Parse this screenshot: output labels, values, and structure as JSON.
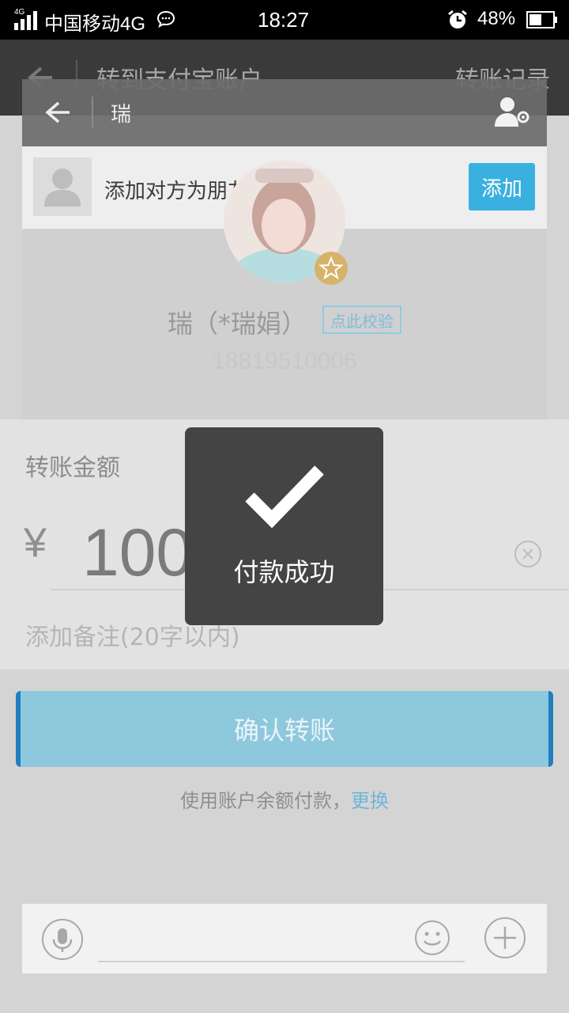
{
  "status_bar": {
    "network_label": "4G",
    "carrier": "中国移动4G",
    "time": "18:27",
    "battery": "48%"
  },
  "transfer_page": {
    "title": "转到支付宝账户",
    "records_label": "转账记录",
    "amount_label": "转账金额",
    "currency_symbol": "¥",
    "amount": "1000",
    "note_placeholder": "添加备注(20字以内)",
    "confirm_button": "确认转账",
    "payment_method_text": "使用账户余额付款，",
    "payment_change_link": "更换"
  },
  "chat_card": {
    "contact_name": "瑞",
    "add_friend_text": "添加对方为朋友",
    "add_button": "添加"
  },
  "profile": {
    "display_name": "瑞（*瑞娟）",
    "verify_label": "点此校验",
    "phone": "18819510006"
  },
  "toast": {
    "message": "付款成功"
  },
  "colors": {
    "accent_blue": "#3ab0e0",
    "confirm_button": "#8ec8dd",
    "toast_bg": "#444444",
    "link": "#6fb6d8"
  },
  "icons": {
    "back": "arrow-left",
    "person_settings": "person-gear",
    "mic": "microphone",
    "emoji": "smiley",
    "plus": "plus-circle",
    "success": "checkmark",
    "clear": "x-circle",
    "star": "star"
  }
}
